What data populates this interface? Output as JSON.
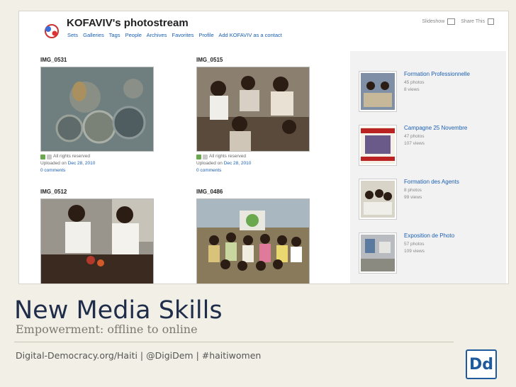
{
  "screenshot": {
    "title": "KOFAVIV's photostream",
    "nav": [
      "Sets",
      "Galleries",
      "Tags",
      "People",
      "Archives",
      "Favorites",
      "Profile",
      "Add KOFAVIV as a contact"
    ],
    "slideshow_label": "Slideshow",
    "share_label": "Share This",
    "photos": [
      {
        "title": "IMG_0531",
        "rights": "All rights reserved",
        "uploaded_prefix": "Uploaded on",
        "date": "Dec 28, 2010",
        "comments": "0 comments"
      },
      {
        "title": "IMG_0515",
        "rights": "All rights reserved",
        "uploaded_prefix": "Uploaded on",
        "date": "Dec 28, 2010",
        "comments": "0 comments"
      },
      {
        "title": "IMG_0512"
      },
      {
        "title": "IMG_0486"
      }
    ],
    "sets": [
      {
        "name": "Formation Professionnelle",
        "photos": "45 photos",
        "views": "8 views"
      },
      {
        "name": "Campagne 25 Novembre",
        "photos": "47 photos",
        "views": "107 views"
      },
      {
        "name": "Formation des Agents",
        "photos": "8 photos",
        "views": "99 views"
      },
      {
        "name": "Exposition de Photo",
        "photos": "57 photos",
        "views": "109 views"
      }
    ]
  },
  "slide": {
    "title": "New Media Skills",
    "subtitle": "Empowerment: offline to online",
    "footer": "Digital-Democracy.org/Haiti | @DigiDem | #haitiwomen",
    "logo_text": "Dd"
  },
  "colors": {
    "link": "#1a5fb4",
    "slide_bg": "#f1efe6",
    "title": "#1f2d4a",
    "logo": "#1e5a9c"
  }
}
